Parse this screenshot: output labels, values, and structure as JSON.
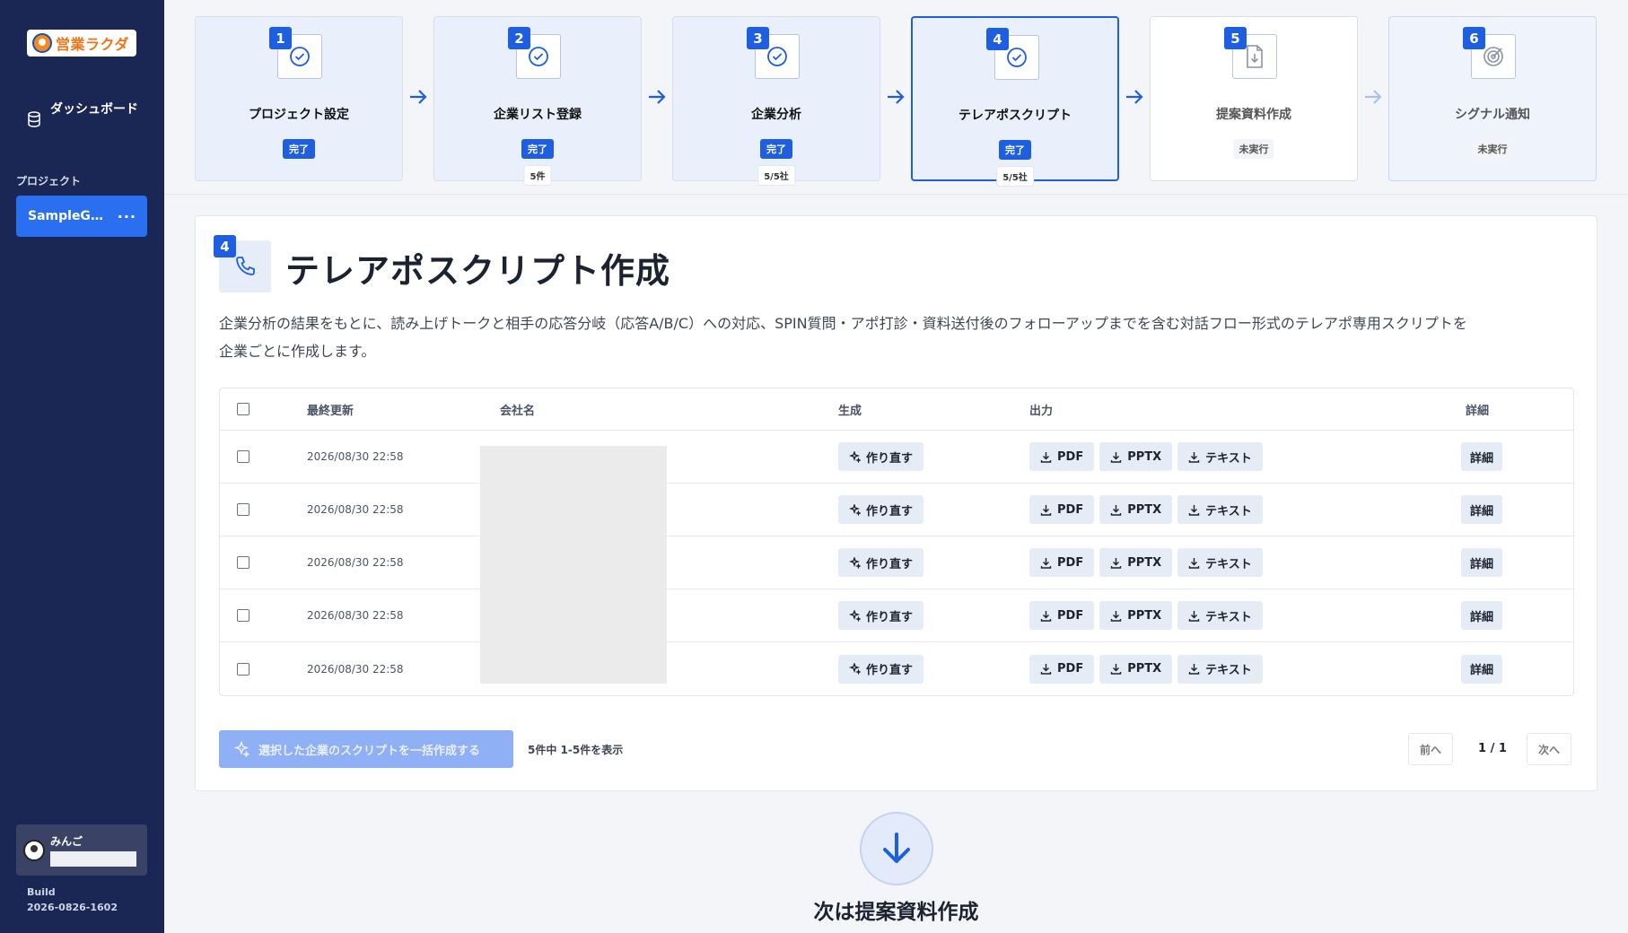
{
  "app": {
    "logo_text": "営業ラクダ",
    "brand_color": "#f07318"
  },
  "sidebar": {
    "dashboard_label": "ダッシュボード",
    "section_label": "プロジェクト",
    "project_name": "SampleGi…",
    "project_menu": "···",
    "user_name": "みんご",
    "build_label": "Build",
    "build_version": "2026-0826-1602"
  },
  "steps": [
    {
      "num": "1",
      "title": "プロジェクト設定",
      "status": "完了",
      "count": "",
      "state": "done"
    },
    {
      "num": "2",
      "title": "企業リスト登録",
      "status": "完了",
      "count": "5件",
      "state": "done"
    },
    {
      "num": "3",
      "title": "企業分析",
      "status": "完了",
      "count": "5/5社",
      "state": "done"
    },
    {
      "num": "4",
      "title": "テレアポスクリプト",
      "status": "完了",
      "count": "5/5社",
      "state": "active"
    },
    {
      "num": "5",
      "title": "提案資料作成",
      "status": "未実行",
      "count": "",
      "state": "pending"
    },
    {
      "num": "6",
      "title": "シグナル通知",
      "status": "未実行",
      "count": "",
      "state": "pending"
    }
  ],
  "main": {
    "step_num": "4",
    "title": "テレアポスクリプト作成",
    "description": "企業分析の結果をもとに、読み上げトークと相手の応答分岐（応答A/B/C）への対応、SPIN質問・アポ打診・資料送付後のフォローアップまでを含む対話フロー形式のテレアポ専用スクリプトを企業ごとに作成します。"
  },
  "table": {
    "headers": {
      "updated": "最終更新",
      "company": "会社名",
      "generate": "生成",
      "output": "出力",
      "detail": "詳細"
    },
    "rows": [
      {
        "updated": "2026/08/30 22:58",
        "regen": "作り直す",
        "pdf": "PDF",
        "pptx": "PPTX",
        "text": "テキスト",
        "detail": "詳細"
      },
      {
        "updated": "2026/08/30 22:58",
        "regen": "作り直す",
        "pdf": "PDF",
        "pptx": "PPTX",
        "text": "テキスト",
        "detail": "詳細"
      },
      {
        "updated": "2026/08/30 22:58",
        "regen": "作り直す",
        "pdf": "PDF",
        "pptx": "PPTX",
        "text": "テキスト",
        "detail": "詳細"
      },
      {
        "updated": "2026/08/30 22:58",
        "regen": "作り直す",
        "pdf": "PDF",
        "pptx": "PPTX",
        "text": "テキスト",
        "detail": "詳細"
      },
      {
        "updated": "2026/08/30 22:58",
        "regen": "作り直す",
        "pdf": "PDF",
        "pptx": "PPTX",
        "text": "テキスト",
        "detail": "詳細"
      }
    ]
  },
  "footer": {
    "bulk_button": "選択した企業のスクリプトを一括作成する",
    "count_text": "5件中 1-5件を表示",
    "prev": "前へ",
    "page": "1 / 1",
    "next": "次へ"
  },
  "next_step": {
    "label": "次は提案資料作成"
  },
  "colors": {
    "sidebar_bg": "#1a2654",
    "accent": "#1d5fe0",
    "bulk_button_disabled": "#8fb0f5"
  }
}
